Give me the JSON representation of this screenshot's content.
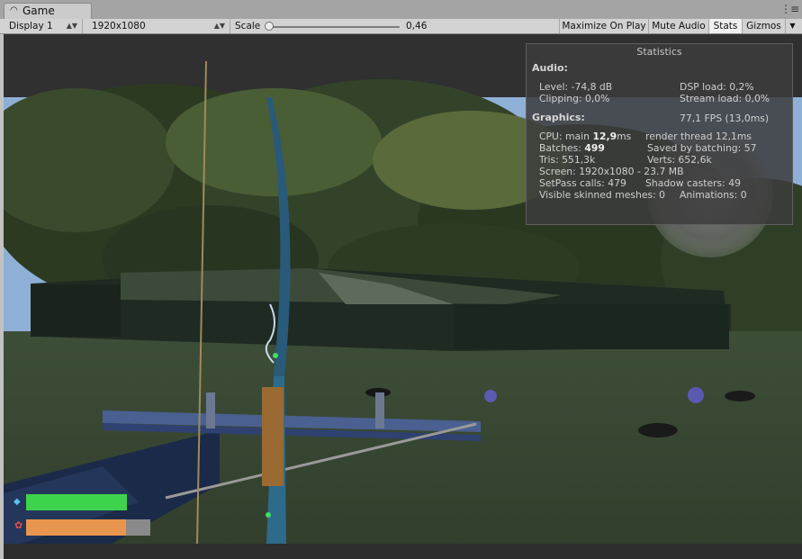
{
  "window": {
    "tab_title": "Game",
    "tab_icon": "unity-game-icon",
    "menu_icon": "more-options-icon"
  },
  "toolbar": {
    "display": "Display 1",
    "resolution": "1920x1080",
    "scale_label": "Scale",
    "scale_value": "0,46",
    "scale_fraction": 0.0,
    "buttons": [
      "Maximize On Play",
      "Mute Audio",
      "Stats",
      "Gizmos"
    ],
    "active_button": "Stats"
  },
  "stats": {
    "title": "Statistics",
    "audio_header": "Audio:",
    "level": "Level: -74,8 dB",
    "clipping": "Clipping: 0,0%",
    "dsp_load": "DSP load: 0,2%",
    "stream_load": "Stream load: 0,0%",
    "graphics_header": "Graphics:",
    "fps": "77,1 FPS (13,0ms)",
    "cpu_label": "CPU: main ",
    "cpu_main": "12,9",
    "cpu_unit": "ms",
    "render_thread": "render thread 12,1ms",
    "batches_label": "Batches: ",
    "batches_value": "499",
    "saved_batching": "Saved by batching: 57",
    "tris": "Tris: 551,3k",
    "verts": "Verts: 652,6k",
    "screen": "Screen: 1920x1080 - 23.7 MB",
    "setpass": "SetPass calls: 479",
    "shadow_casters": "Shadow casters: 49",
    "skinned": "Visible skinned meshes: 0",
    "animations": "Animations: 0"
  },
  "hud": {
    "health_fraction": 0.81,
    "stamina_fraction": 0.8
  },
  "colors": {
    "health": "#3ed34d",
    "stamina": "#e8964f",
    "sky": "#8fb0d6",
    "grass": "#3b4b35",
    "panel": "#3c3c3c"
  }
}
